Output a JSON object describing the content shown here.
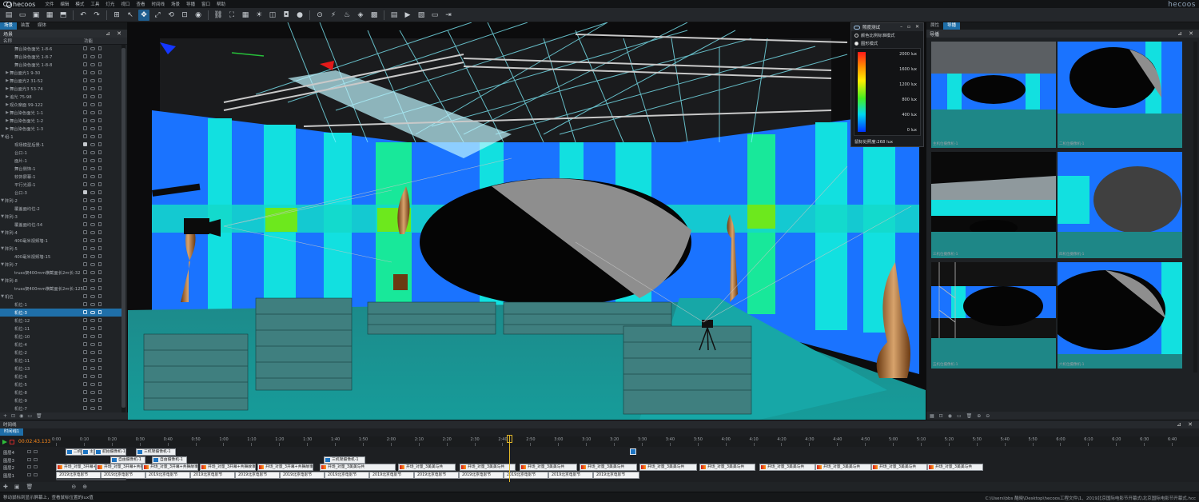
{
  "app": {
    "brand": "hecoos",
    "menu": [
      "文件",
      "编辑",
      "模式",
      "工具",
      "灯光",
      "视口",
      "查看",
      "时间线",
      "场景",
      "导播",
      "窗口",
      "帮助"
    ]
  },
  "toolbar": {
    "icons": [
      "new-file-icon",
      "open-folder-icon",
      "save-icon",
      "save-as-icon",
      "import-icon",
      "undo-icon",
      "redo-icon",
      "stage-box-icon",
      "select-arrow-icon",
      "move-icon",
      "scale-icon",
      "rotate-icon",
      "lock-icon",
      "eye-icon",
      "link-icon",
      "fullscreen-icon",
      "grid-icon",
      "light-icon",
      "layer-icon",
      "camera-icon",
      "record-icon",
      "focus-icon",
      "beam-icon",
      "spot-icon",
      "render-icon",
      "matrix-icon",
      "table-icon",
      "video-icon",
      "photo-icon",
      "screen-icon",
      "exit-icon"
    ],
    "active_index": 9
  },
  "left_panel": {
    "tabs": [
      "场景",
      "装置",
      "媒体"
    ],
    "active_tab": 0,
    "title": "场景",
    "col_name": "名称",
    "col_func": "功能",
    "rows": [
      {
        "label": "舞台染色面光 1-8-6",
        "indent": 2,
        "arrow": "",
        "locked": false
      },
      {
        "label": "舞台染色面光 1-8-7",
        "indent": 2,
        "arrow": "",
        "locked": false
      },
      {
        "label": "舞台染色面光 1-8-8",
        "indent": 2,
        "arrow": "",
        "locked": false
      },
      {
        "label": "舞台面光1 9-30",
        "indent": 1,
        "arrow": "▶",
        "locked": false
      },
      {
        "label": "舞台面光2 31-52",
        "indent": 1,
        "arrow": "▶",
        "locked": false
      },
      {
        "label": "舞台面光3 53-74",
        "indent": 1,
        "arrow": "▶",
        "locked": false
      },
      {
        "label": "追光 75-98",
        "indent": 1,
        "arrow": "▶",
        "locked": false
      },
      {
        "label": "观众席面 99-122",
        "indent": 1,
        "arrow": "▶",
        "locked": false
      },
      {
        "label": "舞台染色面光 1-1",
        "indent": 1,
        "arrow": "▶",
        "locked": false
      },
      {
        "label": "舞台染色面光 1-2",
        "indent": 1,
        "arrow": "▶",
        "locked": false
      },
      {
        "label": "舞台染色面光 1-3",
        "indent": 1,
        "arrow": "▶",
        "locked": false
      },
      {
        "label": "组-1",
        "indent": 0,
        "arrow": "▼",
        "locked": false
      },
      {
        "label": "现场模型后景-1",
        "indent": 2,
        "arrow": "",
        "locked": true
      },
      {
        "label": "台口-1",
        "indent": 2,
        "arrow": "",
        "locked": false
      },
      {
        "label": "面片-1",
        "indent": 2,
        "arrow": "",
        "locked": false
      },
      {
        "label": "舞台侧饰-1",
        "indent": 2,
        "arrow": "",
        "locked": false
      },
      {
        "label": "软饰屏幕-1",
        "indent": 2,
        "arrow": "",
        "locked": false
      },
      {
        "label": "平行光源-1",
        "indent": 2,
        "arrow": "",
        "locked": false
      },
      {
        "label": "台口-3",
        "indent": 2,
        "arrow": "",
        "locked": true
      },
      {
        "label": "阵列-2",
        "indent": 0,
        "arrow": "▼",
        "locked": false
      },
      {
        "label": "覆盖面均位-2",
        "indent": 2,
        "arrow": "",
        "locked": false
      },
      {
        "label": "阵列-3",
        "indent": 0,
        "arrow": "▼",
        "locked": false
      },
      {
        "label": "覆盖面均位-54",
        "indent": 2,
        "arrow": "",
        "locked": false
      },
      {
        "label": "阵列-4",
        "indent": 0,
        "arrow": "▼",
        "locked": false
      },
      {
        "label": "400毫米视频墙-1",
        "indent": 2,
        "arrow": "",
        "locked": false
      },
      {
        "label": "阵列-5",
        "indent": 0,
        "arrow": "▼",
        "locked": false
      },
      {
        "label": "400毫米视频墙-15",
        "indent": 2,
        "arrow": "",
        "locked": false
      },
      {
        "label": "阵列-7",
        "indent": 0,
        "arrow": "▼",
        "locked": false
      },
      {
        "label": "truss架400mm横截面长2m长-32",
        "indent": 2,
        "arrow": "",
        "locked": false
      },
      {
        "label": "阵列-8",
        "indent": 0,
        "arrow": "▼",
        "locked": false
      },
      {
        "label": "truss架400mm横截面长2m长-125",
        "indent": 2,
        "arrow": "",
        "locked": false
      },
      {
        "label": "机位",
        "indent": 0,
        "arrow": "▼",
        "locked": false
      },
      {
        "label": "机位-1",
        "indent": 2,
        "arrow": "",
        "locked": false
      },
      {
        "label": "机位-3",
        "indent": 2,
        "arrow": "",
        "locked": false,
        "selected": true
      },
      {
        "label": "机位-12",
        "indent": 2,
        "arrow": "",
        "locked": false
      },
      {
        "label": "机位-11",
        "indent": 2,
        "arrow": "",
        "locked": false
      },
      {
        "label": "机位-10",
        "indent": 2,
        "arrow": "",
        "locked": false
      },
      {
        "label": "机位-4",
        "indent": 2,
        "arrow": "",
        "locked": false
      },
      {
        "label": "机位-2",
        "indent": 2,
        "arrow": "",
        "locked": false
      },
      {
        "label": "机位-11",
        "indent": 2,
        "arrow": "",
        "locked": false
      },
      {
        "label": "机位-13",
        "indent": 2,
        "arrow": "",
        "locked": false
      },
      {
        "label": "机位-6",
        "indent": 2,
        "arrow": "",
        "locked": false
      },
      {
        "label": "机位-5",
        "indent": 2,
        "arrow": "",
        "locked": false
      },
      {
        "label": "机位-8",
        "indent": 2,
        "arrow": "",
        "locked": false
      },
      {
        "label": "机位-9",
        "indent": 2,
        "arrow": "",
        "locked": false
      },
      {
        "label": "机位-7",
        "indent": 2,
        "arrow": "",
        "locked": false
      }
    ]
  },
  "illuminance": {
    "title": "照度测试",
    "modes": [
      "颜色比例标准模式",
      "图形模式"
    ],
    "selected_mode": 1,
    "scale_labels": [
      "2000 lux",
      "1600 lux",
      "1200 lux",
      "800 lux",
      "400 lux",
      "0 lux"
    ],
    "status": "鼠标处照度:268 lux"
  },
  "right_panel": {
    "tabs": [
      "属性",
      "导播"
    ],
    "active_tab": 1,
    "title": "导播",
    "thumb_captions": [
      "主机位摄像机-1",
      "二机位摄像机-1",
      "三机位摄像机-1",
      "四机位摄像机-1",
      "五机位摄像机-1",
      "六机位摄像机-1"
    ]
  },
  "timeline": {
    "title": "时间线",
    "tab": "时间线1",
    "current_time": "00:02:43.133",
    "ticks": [
      "0:00",
      "0:10",
      "0:20",
      "0:30",
      "0:40",
      "0:50",
      "1:00",
      "1:10",
      "1:20",
      "1:30",
      "1:40",
      "1:50",
      "2:00",
      "2:10",
      "2:20",
      "2:30",
      "2:40",
      "2:50",
      "3:00",
      "3:10",
      "3:20",
      "3:30",
      "3:40",
      "3:50",
      "4:00",
      "4:10",
      "4:20",
      "4:30",
      "4:40",
      "4:50",
      "5:00",
      "5:10",
      "5:20",
      "5:30",
      "5:40",
      "5:50",
      "6:00",
      "6:10",
      "6:20",
      "6:30",
      "6:40"
    ],
    "tracks": [
      {
        "name": "图层4",
        "clips": [
          {
            "label": "二机",
            "type": "cam"
          },
          {
            "label": "主机",
            "type": "cam"
          },
          {
            "label": "航拍摄像机-1",
            "type": "cam"
          },
          {
            "label": "三机架摄像机-1",
            "type": "cam"
          }
        ]
      },
      {
        "name": "图层3",
        "clips": [
          {
            "label": "自由摄像机-1",
            "type": "cam"
          },
          {
            "label": "自由摄像机-1",
            "type": "cam"
          },
          {
            "label": "三机架摄像机-1",
            "type": "cam"
          }
        ]
      },
      {
        "name": "图层2",
        "clips": [
          {
            "label": "开场_对量_3开幕+共舞故事",
            "type": "warm"
          },
          {
            "label": "开场_对量_3开幕+共舞故事",
            "type": "warm"
          },
          {
            "label": "开场_对量_3开幕+共舞故事",
            "type": "warm"
          },
          {
            "label": "开场_对量_3开幕+共舞故事",
            "type": "warm"
          },
          {
            "label": "开场_对量_3开幕+共舞故事",
            "type": "warm"
          },
          {
            "label": "开场_对量_3美美与共",
            "type": "warm"
          },
          {
            "label": "开场_对量_3美美与共",
            "type": "warm"
          },
          {
            "label": "开场_对量_3美美与共",
            "type": "warm"
          },
          {
            "label": "开场_对量_3美美与共",
            "type": "warm"
          },
          {
            "label": "开场_对量_3美美与共",
            "type": "warm"
          },
          {
            "label": "开场_对量_3美美与共",
            "type": "warm"
          },
          {
            "label": "开场_对量_3美美与共",
            "type": "warm"
          },
          {
            "label": "开场_对量_3美美与共",
            "type": "warm"
          },
          {
            "label": "开场_对量_3美美与共",
            "type": "warm"
          },
          {
            "label": "开场_对量_3美美与共",
            "type": "warm"
          },
          {
            "label": "开场_对量_3美美与共",
            "type": "warm"
          }
        ]
      },
      {
        "name": "图层1",
        "clips": [
          {
            "label": "2019北京电影节",
            "type": "plain"
          },
          {
            "label": "2019北京电影节",
            "type": "plain"
          },
          {
            "label": "2019北京电影节",
            "type": "plain"
          },
          {
            "label": "2019北京电影节",
            "type": "plain"
          },
          {
            "label": "2019北京电影节",
            "type": "plain"
          },
          {
            "label": "2019北京电影节",
            "type": "plain"
          },
          {
            "label": "2019北京电影节",
            "type": "plain"
          },
          {
            "label": "2019北京电影节",
            "type": "plain"
          },
          {
            "label": "2019北京电影节",
            "type": "plain"
          },
          {
            "label": "2019北京电影节",
            "type": "plain"
          },
          {
            "label": "2019北京电影节",
            "type": "plain"
          },
          {
            "label": "2019北京电影节",
            "type": "plain"
          },
          {
            "label": "2019北京电影节",
            "type": "plain"
          }
        ]
      }
    ]
  },
  "status": {
    "message": "移动鼠标到显示屏幕上，查看鼠标位置的lux值",
    "path": "C:\\Users\\bbs 酷晓\\Desktop\\hecoos工程文件\\1、2019北京国际电影节开幕式\\北京国际电影节开幕式.hcc"
  }
}
